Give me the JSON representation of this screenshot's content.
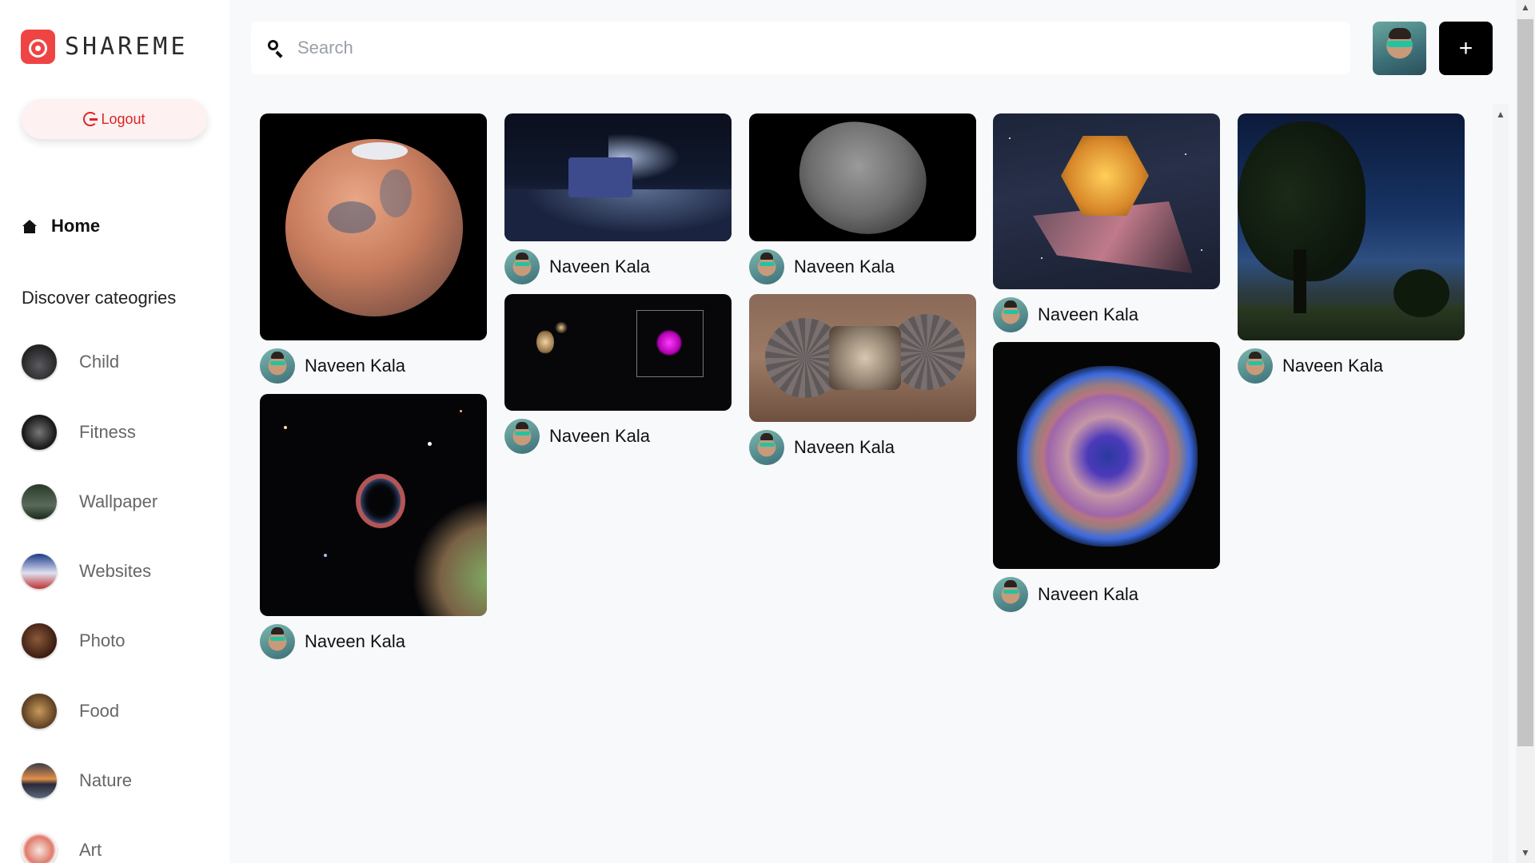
{
  "app": {
    "name": "SHAREME"
  },
  "sidebar": {
    "logout_label": "Logout",
    "home_label": "Home",
    "discover_label": "Discover cateogries",
    "categories": [
      {
        "label": "Child"
      },
      {
        "label": "Fitness"
      },
      {
        "label": "Wallpaper"
      },
      {
        "label": "Websites"
      },
      {
        "label": "Photo"
      },
      {
        "label": "Food"
      },
      {
        "label": "Nature"
      },
      {
        "label": "Art"
      }
    ]
  },
  "header": {
    "search_placeholder": "Search",
    "add_button_label": "+"
  },
  "pins": [
    {
      "image": "mars-planet",
      "author": "Naveen Kala"
    },
    {
      "image": "lunar-rover",
      "author": "Naveen Kala"
    },
    {
      "image": "asteroid",
      "author": "Naveen Kala"
    },
    {
      "image": "space-telescope",
      "author": "Naveen Kala"
    },
    {
      "image": "night-sky-tree",
      "author": "Naveen Kala"
    },
    {
      "image": "galaxy-xray",
      "author": "Naveen Kala"
    },
    {
      "image": "mars-lander",
      "author": "Naveen Kala"
    },
    {
      "image": "supernova-remnant",
      "author": "Naveen Kala"
    },
    {
      "image": "nebula-ring",
      "author": "Naveen Kala"
    }
  ],
  "colors": {
    "brand": "#ef4444",
    "logout_text": "#dc2626",
    "background": "#f8f9fb"
  }
}
